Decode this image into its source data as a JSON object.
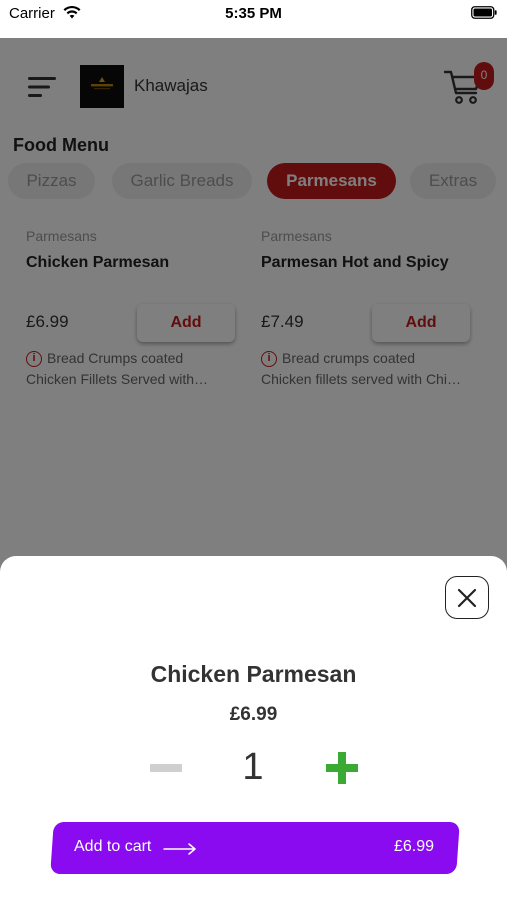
{
  "status_bar": {
    "carrier": "Carrier",
    "time": "5:35 PM",
    "wifi_icon": "wifi-icon",
    "battery_icon": "battery-full-icon"
  },
  "header": {
    "menu_icon": "hamburger-menu-icon",
    "brand_name": "Khawajas",
    "cart_icon": "shopping-cart-icon",
    "cart_count": "0"
  },
  "menu": {
    "title": "Food Menu",
    "tabs": [
      {
        "label": "Pizzas",
        "active": false
      },
      {
        "label": "Garlic Breads",
        "active": false
      },
      {
        "label": "Parmesans",
        "active": true
      },
      {
        "label": "Extras",
        "active": false
      }
    ],
    "items": [
      {
        "category": "Parmesans",
        "name": "Chicken Parmesan",
        "price": "£6.99",
        "add_label": "Add",
        "desc_line1": "Bread Crumps coated",
        "desc_line2": "Chicken Fillets Served with…"
      },
      {
        "category": "Parmesans",
        "name": "Parmesan Hot and Spicy",
        "price": "£7.49",
        "add_label": "Add",
        "desc_line1": "Bread crumps coated",
        "desc_line2": "Chicken fillets served with Chi…"
      }
    ]
  },
  "sheet": {
    "title": "Chicken Parmesan",
    "price": "£6.99",
    "quantity": "1",
    "add_to_cart_label": "Add to cart",
    "add_to_cart_price": "£6.99",
    "close_icon": "close-icon"
  },
  "colors": {
    "brand_red": "#c41a1a",
    "purple": "#8a0bf0",
    "plus_green": "#3aaa35"
  }
}
